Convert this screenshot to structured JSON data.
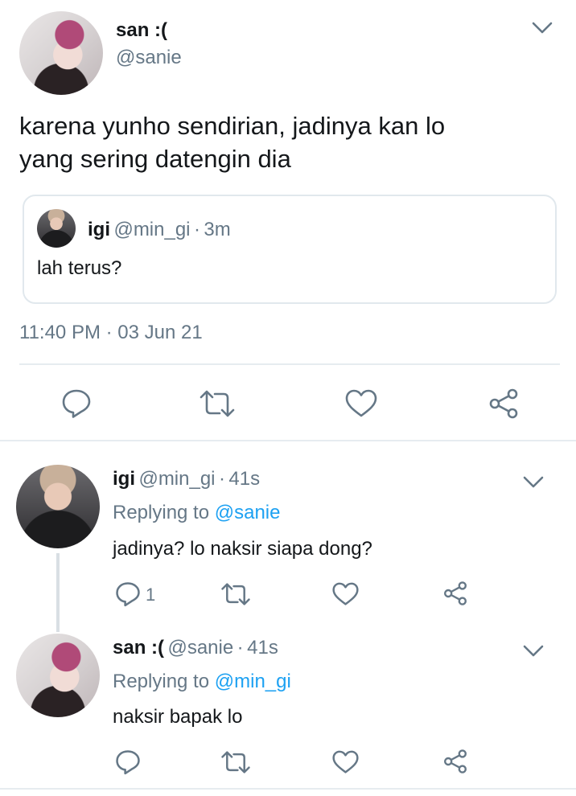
{
  "main_tweet": {
    "author_name": "san :(",
    "author_handle": "@sanie",
    "text_line1": "karena yunho sendirian, jadinya kan lo",
    "text_line2": "yang sering datengin dia",
    "quoted": {
      "author_name": "igi",
      "author_handle": "@min_gi",
      "separator": "·",
      "time": "3m",
      "text": "lah terus?"
    },
    "timestamp": "11:40 PM · 03 Jun 21"
  },
  "replies": [
    {
      "author_name": "igi",
      "author_handle": "@min_gi",
      "separator": "·",
      "time": "41s",
      "replying_prefix": "Replying to",
      "replying_to": "@sanie",
      "text": "jadinya? lo naksir siapa dong?",
      "reply_count": "1"
    },
    {
      "author_name": "san :(",
      "author_handle": "@sanie",
      "separator": "·",
      "time": "41s",
      "replying_prefix": "Replying to",
      "replying_to": "@min_gi",
      "text": "naksir bapak lo",
      "reply_count": ""
    }
  ],
  "icons": {
    "reply": "reply-icon",
    "retweet": "retweet-icon",
    "like": "like-icon",
    "share": "share-icon",
    "menu": "chevron-down-icon"
  },
  "colors": {
    "link": "#1da1f2",
    "secondary_text": "#657786",
    "icon": "#657786",
    "border": "#e1e8ed"
  }
}
